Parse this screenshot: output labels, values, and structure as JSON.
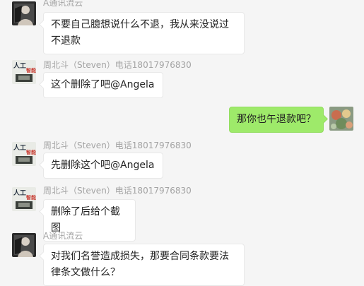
{
  "messages": [
    {
      "sender": "A通讯流云",
      "text": "不要自己臆想说什么不退，我从来没说过不退款",
      "avatar_icon": "avatar-photo-icon"
    },
    {
      "sender": "周北斗（Steven）电话18017976830",
      "text": "这个删除了吧@Angela",
      "avatar_icon": "avatar-book-cover-icon",
      "avatar_caption": "人工智能"
    },
    {
      "text": "那你也午退款吧？",
      "avatar_icon": "avatar-food-photo-icon"
    },
    {
      "sender": "周北斗（Steven）电话18017976830",
      "text": "先删除这个吧@Angela",
      "avatar_icon": "avatar-book-cover-icon",
      "avatar_caption": "人工智能"
    },
    {
      "sender": "周北斗（Steven）电话18017976830",
      "text": "删除了后给个截图",
      "avatar_icon": "avatar-book-cover-icon",
      "avatar_caption": "人工智能"
    },
    {
      "sender": "A通讯流云",
      "text": "对我们名誉造成损失，那要合同条款要法律条文做什么？",
      "avatar_icon": "avatar-photo-icon"
    }
  ],
  "colors": {
    "background": "#f5f5f5",
    "incoming_bubble": "#ffffff",
    "outgoing_bubble": "#9eea6a",
    "sender_name": "#a3a3a3"
  }
}
